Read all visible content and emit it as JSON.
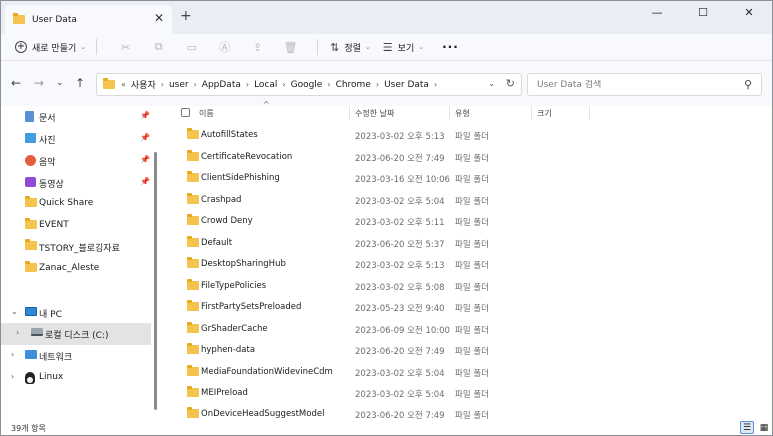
{
  "window": {
    "tab_title": "User Data",
    "tab_close": "✕",
    "new_tab": "+",
    "minimize": "—",
    "maximize": "☐",
    "close": "✕"
  },
  "toolbar": {
    "new_label": "새로 만들기",
    "sort_label": "정렬",
    "view_label": "보기",
    "more_label": "···"
  },
  "address": {
    "prefix": "«",
    "crumbs": [
      "사용자",
      "user",
      "AppData",
      "Local",
      "Google",
      "Chrome",
      "User Data"
    ],
    "search_placeholder": "User Data 검색"
  },
  "sidebar": {
    "pinned": [
      {
        "label": "문서",
        "icon": "documents-icon"
      },
      {
        "label": "사진",
        "icon": "pictures-icon"
      },
      {
        "label": "음악",
        "icon": "music-icon"
      },
      {
        "label": "동영상",
        "icon": "videos-icon"
      }
    ],
    "folders": [
      "Quick Share",
      "EVENT",
      "TSTORY_블로깅자료",
      "Zanac_Aleste"
    ],
    "this_pc": "내 PC",
    "local_disk": "로컬 디스크 (C:)",
    "network": "네트워크",
    "linux": "Linux"
  },
  "columns": {
    "name": "이름",
    "modified": "수정한 날짜",
    "type": "유형",
    "size": "크기"
  },
  "files": [
    {
      "name": "AutofillStates",
      "date": "2023-03-02 오후 5:13",
      "type": "파일 폴더"
    },
    {
      "name": "CertificateRevocation",
      "date": "2023-06-20 오전 7:49",
      "type": "파일 폴더"
    },
    {
      "name": "ClientSidePhishing",
      "date": "2023-03-16 오전 10:06",
      "type": "파일 폴더"
    },
    {
      "name": "Crashpad",
      "date": "2023-03-02 오후 5:04",
      "type": "파일 폴더"
    },
    {
      "name": "Crowd Deny",
      "date": "2023-03-02 오후 5:11",
      "type": "파일 폴더"
    },
    {
      "name": "Default",
      "date": "2023-06-20 오전 5:37",
      "type": "파일 폴더"
    },
    {
      "name": "DesktopSharingHub",
      "date": "2023-03-02 오후 5:13",
      "type": "파일 폴더"
    },
    {
      "name": "FileTypePolicies",
      "date": "2023-03-02 오후 5:08",
      "type": "파일 폴더"
    },
    {
      "name": "FirstPartySetsPreloaded",
      "date": "2023-05-23 오전 9:40",
      "type": "파일 폴더"
    },
    {
      "name": "GrShaderCache",
      "date": "2023-06-09 오전 10:00",
      "type": "파일 폴더"
    },
    {
      "name": "hyphen-data",
      "date": "2023-06-20 오전 7:49",
      "type": "파일 폴더"
    },
    {
      "name": "MediaFoundationWidevineCdm",
      "date": "2023-03-02 오후 5:04",
      "type": "파일 폴더"
    },
    {
      "name": "MEIPreload",
      "date": "2023-03-02 오후 5:04",
      "type": "파일 폴더"
    },
    {
      "name": "OnDeviceHeadSuggestModel",
      "date": "2023-06-20 오전 7:49",
      "type": "파일 폴더"
    }
  ],
  "status": {
    "item_count": "39개 항목"
  }
}
